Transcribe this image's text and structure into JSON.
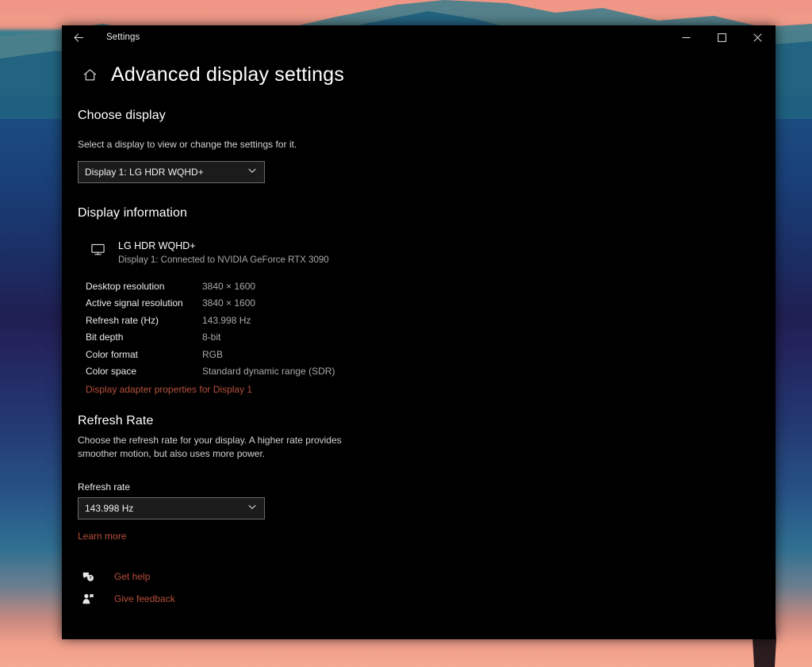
{
  "window": {
    "app_title": "Settings",
    "back_icon": "back-arrow-icon",
    "minimize_label": "─",
    "maximize_label": "☐",
    "close_label": "✕"
  },
  "page": {
    "home_icon": "home-icon",
    "title": "Advanced display settings"
  },
  "choose_display": {
    "heading": "Choose display",
    "description": "Select a display to view or change the settings for it.",
    "dropdown": {
      "name": "display-select",
      "value": "Display 1: LG HDR WQHD+",
      "chevron_icon": "chevron-down-icon"
    }
  },
  "display_information": {
    "heading": "Display information",
    "monitor_icon": "monitor-icon",
    "device_name": "LG HDR WQHD+",
    "device_connection": "Display 1: Connected to NVIDIA GeForce RTX 3090",
    "specs": [
      {
        "label": "Desktop resolution",
        "value": "3840 × 1600"
      },
      {
        "label": "Active signal resolution",
        "value": "3840 × 1600"
      },
      {
        "label": "Refresh rate (Hz)",
        "value": "143.998 Hz"
      },
      {
        "label": "Bit depth",
        "value": "8-bit"
      },
      {
        "label": "Color format",
        "value": "RGB"
      },
      {
        "label": "Color space",
        "value": "Standard dynamic range (SDR)"
      }
    ],
    "adapter_link": "Display adapter properties for Display 1"
  },
  "refresh_rate": {
    "heading": "Refresh Rate",
    "description": "Choose the refresh rate for your display. A higher rate provides smoother motion, but also uses more power.",
    "field_label": "Refresh rate",
    "dropdown": {
      "name": "refresh-rate-select",
      "value": "143.998 Hz",
      "chevron_icon": "chevron-down-icon"
    },
    "learn_more": "Learn more"
  },
  "footer": {
    "links": [
      {
        "label": "Get help",
        "icon": "help-bubble-icon"
      },
      {
        "label": "Give feedback",
        "icon": "feedback-person-icon"
      }
    ]
  },
  "colors": {
    "accent_link": "#b7503c",
    "window_background": "#000000",
    "primary_text": "#ffffff",
    "secondary_text": "#a9a9a9"
  }
}
